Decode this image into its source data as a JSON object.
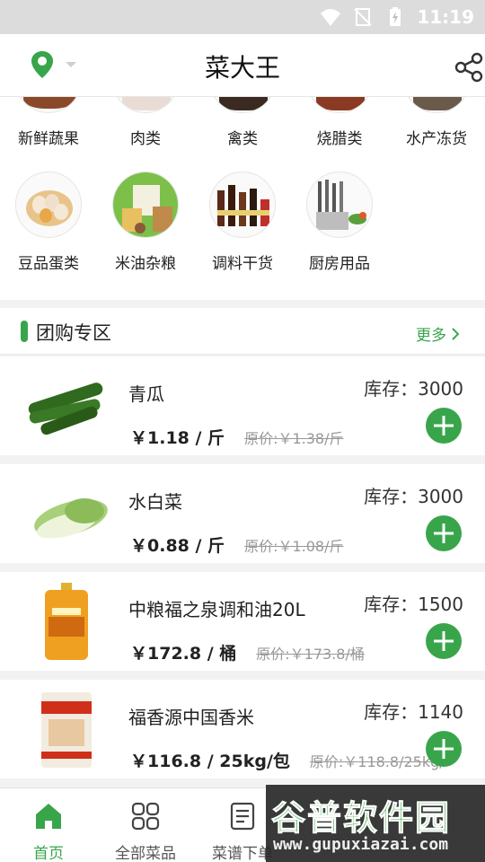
{
  "status": {
    "time": "11:19"
  },
  "header": {
    "title": "菜大王"
  },
  "categories": [
    {
      "label": "新鲜蔬果",
      "icon": "vegetables-icon"
    },
    {
      "label": "肉类",
      "icon": "meat-icon"
    },
    {
      "label": "禽类",
      "icon": "poultry-icon"
    },
    {
      "label": "烧腊类",
      "icon": "roast-meat-icon"
    },
    {
      "label": "水产冻货",
      "icon": "seafood-icon"
    },
    {
      "label": "豆品蛋类",
      "icon": "eggs-icon"
    },
    {
      "label": "米油杂粮",
      "icon": "rice-oil-icon"
    },
    {
      "label": "调料干货",
      "icon": "seasoning-icon"
    },
    {
      "label": "厨房用品",
      "icon": "kitchenware-icon"
    }
  ],
  "group": {
    "title": "团购专区",
    "more": "更多"
  },
  "products": [
    {
      "name": "青瓜",
      "stock": "库存：3000",
      "price": "￥1.18 / 斤",
      "orig": "原价:￥1.38/斤",
      "icon": "cucumber-icon"
    },
    {
      "name": "水白菜",
      "stock": "库存：3000",
      "price": "￥0.88 / 斤",
      "orig": "原价:￥1.08/斤",
      "icon": "cabbage-icon"
    },
    {
      "name": "中粮福之泉调和油20L",
      "stock": "库存：1500",
      "price": "￥172.8 / 桶",
      "orig": "原价:￥173.8/桶",
      "icon": "oil-barrel-icon"
    },
    {
      "name": "福香源中国香米",
      "stock": "库存：1140",
      "price": "￥116.8 / 25kg/包",
      "orig": "原价:￥118.8/25kg/",
      "icon": "rice-bag-icon"
    }
  ],
  "tabs": [
    {
      "label": "首页",
      "icon": "home-icon"
    },
    {
      "label": "全部菜品",
      "icon": "grid-icon"
    },
    {
      "label": "菜谱下单",
      "icon": "recipe-icon"
    }
  ],
  "watermark": {
    "line1": "谷普软件园",
    "line2": "www.gupuxiazai.com"
  },
  "colors": {
    "accent": "#39a54b"
  }
}
